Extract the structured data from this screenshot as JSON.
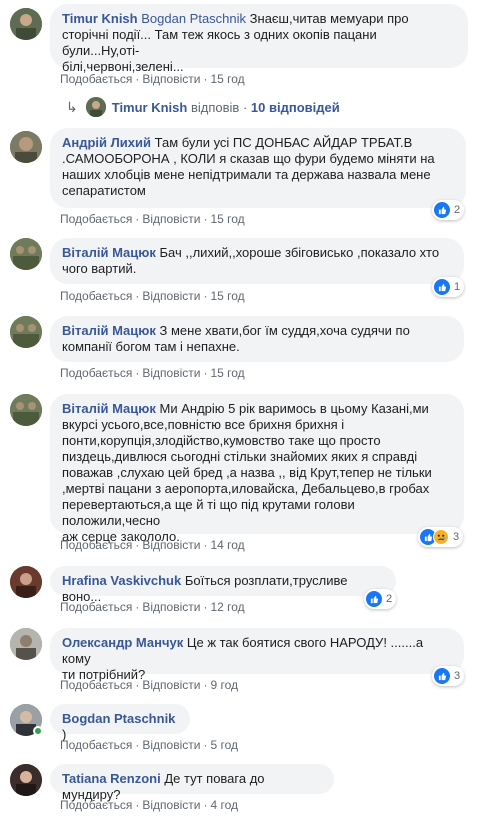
{
  "meta_labels": {
    "like": "Подобається",
    "reply": "Відповісти",
    "sep": "·"
  },
  "comments": [
    {
      "author": "Timur Knish",
      "tagged": "Bogdan Ptaschnik",
      "text_lines": [
        "Знаєш,читав мемуари про",
        "сторічні події... Там теж якось з одних окопів пацани були...Ну,оті-",
        "білі,червоні,зелені..."
      ],
      "time": "15 год"
    },
    {
      "author": "Андрій Лихий",
      "text_lines": [
        "Там були усі ПС ДОНБАС АЙДАР ТРБАТ.В",
        ".САМООБОРОНА , КОЛИ я сказав що фури будемо міняти на",
        "наших хлобців мене непідтримали та держава назвала мене",
        "сепаратистом"
      ],
      "time": "15 год",
      "reactions": "2"
    },
    {
      "author": "Віталій Мацюк",
      "text_lines": [
        "Бач ,,лихий,,хороше збіговисько ,показало хто",
        "чого вартий."
      ],
      "time": "15 год",
      "reactions": "1"
    },
    {
      "author": "Віталій Мацюк",
      "text_lines": [
        "З мене хвати,бог їм суддя,хоча судячи по",
        "компанії богом там і непахне."
      ],
      "time": "15 год"
    },
    {
      "author": "Віталій Мацюк",
      "text_lines": [
        "Ми Андрію 5 рік варимось в цьому Казані,ми",
        "вкурсі усього,все,повністю все брихня брихня і",
        "понти,корупція,злодійство,кумовство таке що просто",
        "пиздець,дивлюся сьогодні стільки знайомих яких я справді",
        "поважав ,слухаю цей бред ,а назва ,, від Крут,тепер не тільки",
        ",мертві пацани з аеропорта,иловайска, Дебальцево,в гробах",
        "перевертаються,а ще й ті що під крутами голови положили,чесно",
        "аж серце закололо."
      ],
      "time": "14 год",
      "reactions": "3"
    },
    {
      "author": "Hrafina Vaskivchuk",
      "text_lines": [
        "Боїться розплати,трусливе воно..."
      ],
      "time": "12 год",
      "reactions": "2"
    },
    {
      "author": "Олександр Манчук",
      "text_lines": [
        "Це ж так боятися свого НАРОДУ! .......а кому",
        "ти потрібний?"
      ],
      "time": "9 год",
      "reactions": "3"
    },
    {
      "author": "Bogdan Ptaschnik",
      "text_lines": [
        ")"
      ],
      "time": "5 год"
    },
    {
      "author": "Tatiana Renzoni",
      "text_lines": [
        "Де тут повага до мундиру?"
      ],
      "time": "4 год"
    }
  ],
  "replies_summary": {
    "author": "Timur Knish",
    "action": "відповів",
    "sep": "·",
    "count_label": "10 відповідей"
  },
  "colors": {
    "link": "#385898",
    "bubble": "#f2f3f5",
    "meta": "#606770",
    "like": "#1877f2",
    "online": "#31a24c"
  }
}
